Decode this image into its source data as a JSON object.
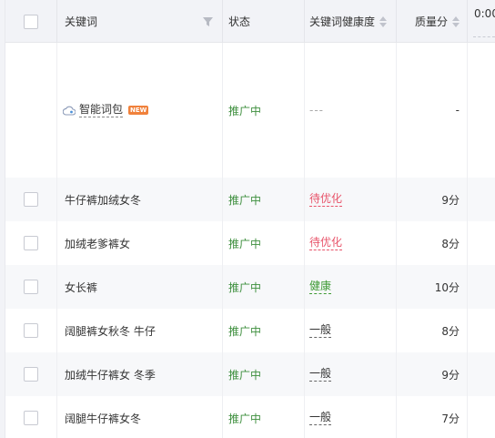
{
  "header": {
    "keyword": "关键词",
    "status": "状态",
    "health": "关键词健康度",
    "score": "质量分",
    "extra": "0:00"
  },
  "smart_row": {
    "label": "智能词包",
    "badge": "NEW",
    "status": "推广中",
    "health": "---",
    "score": "-"
  },
  "rows": [
    {
      "keyword": "牛仔裤加绒女冬",
      "status": "推广中",
      "health": "待优化",
      "score": "9分"
    },
    {
      "keyword": "加绒老爹裤女",
      "status": "推广中",
      "health": "待优化",
      "score": "8分"
    },
    {
      "keyword": "女长裤",
      "status": "推广中",
      "health": "健康",
      "score": "10分"
    },
    {
      "keyword": "阔腿裤女秋冬 牛仔",
      "status": "推广中",
      "health": "一般",
      "score": "8分"
    },
    {
      "keyword": "加绒牛仔裤女 冬季",
      "status": "推广中",
      "health": "一般",
      "score": "9分"
    },
    {
      "keyword": "阔腿牛仔裤女冬",
      "status": "推广中",
      "health": "一般",
      "score": "7分"
    }
  ],
  "colors": {
    "status_green": "#3e8f3e",
    "health_warning": "#e8546a",
    "health_good": "#3e9a34",
    "badge_orange": "#f0813b",
    "header_bg": "#f2f3f7"
  },
  "icons": {
    "filter": "filter-icon",
    "sort": "sort-icon",
    "cloud": "cloud-package-icon"
  }
}
